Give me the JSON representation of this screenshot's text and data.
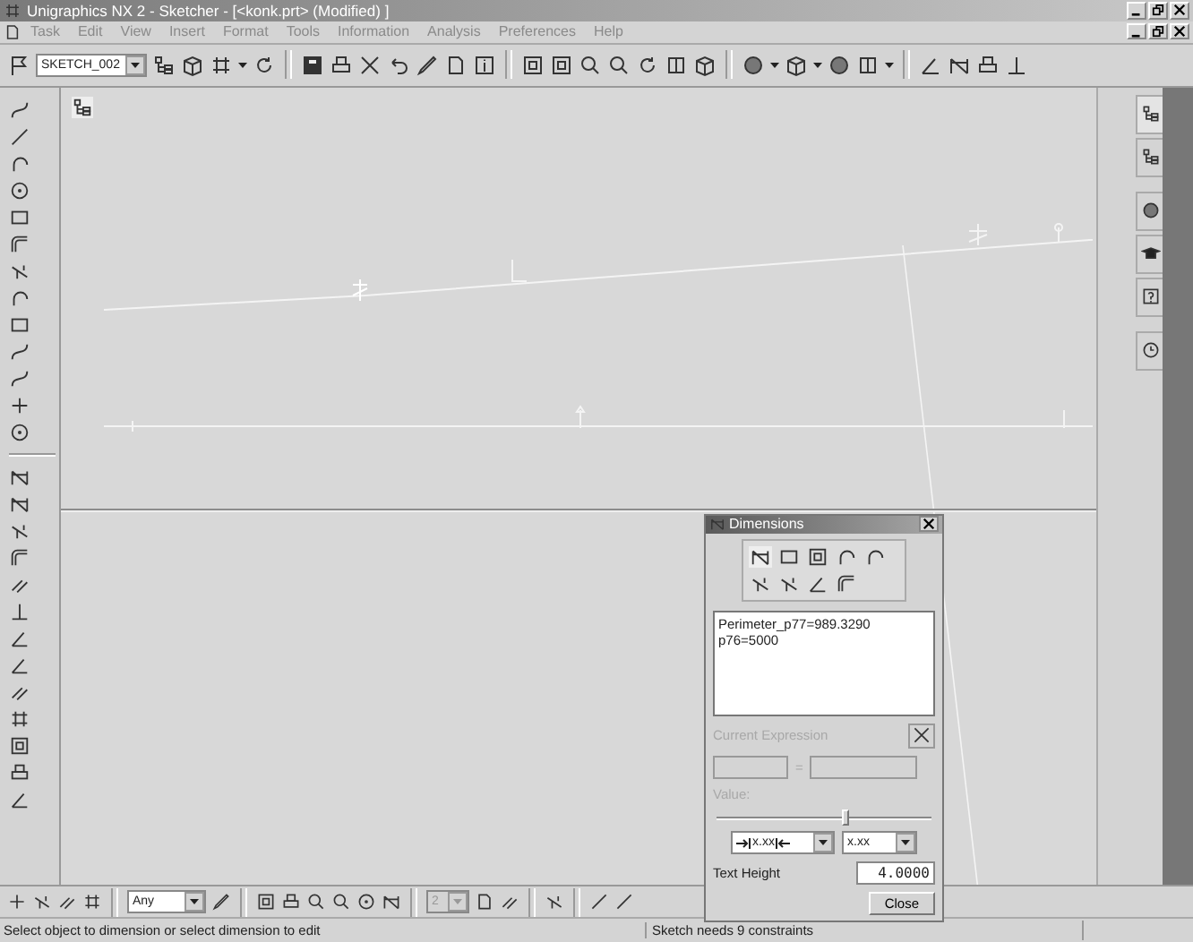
{
  "window": {
    "title": "Unigraphics NX 2 - Sketcher - [<konk.prt> (Modified) ]"
  },
  "menu": [
    {
      "label": "Task"
    },
    {
      "label": "Edit"
    },
    {
      "label": "View"
    },
    {
      "label": "Insert"
    },
    {
      "label": "Format"
    },
    {
      "label": "Tools"
    },
    {
      "label": "Information"
    },
    {
      "label": "Analysis"
    },
    {
      "label": "Preferences"
    },
    {
      "label": "Help"
    }
  ],
  "toolbar": {
    "sketch_name": "SKETCH_002"
  },
  "dialog": {
    "title": "Dimensions",
    "expressions": [
      "Perimeter_p77=989.3290",
      "p76=5000"
    ],
    "current_expression": {
      "label": "Current Expression",
      "equals": "=",
      "disabled": true
    },
    "value": {
      "label": "Value:",
      "disabled": true,
      "level": 0.6
    },
    "placement_option": "x.xx",
    "leader_option": "x.xx",
    "text_height": {
      "label": "Text Height",
      "value": "4.0000"
    },
    "close": "Close"
  },
  "bottom_toolbar": {
    "filter": "Any",
    "grid": {
      "value": "2",
      "disabled": true
    }
  },
  "status_bar": {
    "message": "Select object to dimension or select dimension to edit",
    "constraints": "Sketch needs 9 constraints"
  }
}
